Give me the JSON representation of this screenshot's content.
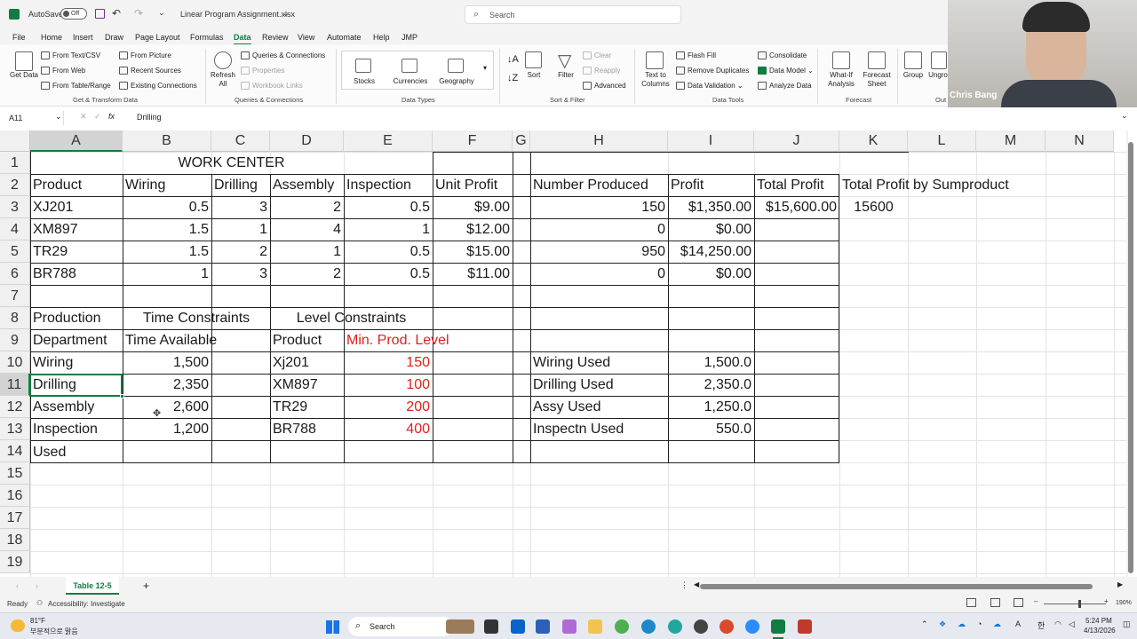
{
  "titlebar": {
    "autosave_label": "AutoSave",
    "autosave_state": "Off",
    "filename": "Linear Program Assignment.xlsx",
    "search_placeholder": "Search"
  },
  "tabs": [
    "File",
    "Home",
    "Insert",
    "Draw",
    "Page Layout",
    "Formulas",
    "Data",
    "Review",
    "View",
    "Automate",
    "Help",
    "JMP"
  ],
  "active_tab": "Data",
  "ribbon": {
    "get_data": "Get Data",
    "from_text_csv": "From Text/CSV",
    "from_web": "From Web",
    "from_table_range": "From Table/Range",
    "from_picture": "From Picture",
    "recent_sources": "Recent Sources",
    "existing_connections": "Existing Connections",
    "group_get_transform": "Get & Transform Data",
    "refresh_all": "Refresh All",
    "queries_connections": "Queries & Connections",
    "properties": "Properties",
    "workbook_links": "Workbook Links",
    "group_queries": "Queries & Connections",
    "stocks": "Stocks",
    "currencies": "Currencies",
    "geography": "Geography",
    "group_data_types": "Data Types",
    "sort_label": "Sort",
    "filter_label": "Filter",
    "clear": "Clear",
    "reapply": "Reapply",
    "advanced": "Advanced",
    "group_sort_filter": "Sort & Filter",
    "text_to_columns": "Text to Columns",
    "flash_fill": "Flash Fill",
    "remove_duplicates": "Remove Duplicates",
    "data_validation": "Data Validation",
    "consolidate": "Consolidate",
    "data_model": "Data Model",
    "analyze_data": "Analyze Data",
    "group_data_tools": "Data Tools",
    "what_if": "What-If Analysis",
    "forecast_sheet": "Forecast Sheet",
    "group_forecast": "Forecast",
    "group": "Group",
    "ungroup": "Ungro",
    "group_outline": "Out"
  },
  "formula_bar": {
    "name_box": "A11",
    "fx": "fx",
    "content": "Drilling"
  },
  "columns": [
    "A",
    "B",
    "C",
    "D",
    "E",
    "F",
    "G",
    "H",
    "I",
    "J",
    "K",
    "L",
    "M",
    "N"
  ],
  "rows": [
    "1",
    "2",
    "3",
    "4",
    "5",
    "6",
    "7",
    "8",
    "9",
    "10",
    "11",
    "12",
    "13",
    "14",
    "15",
    "16",
    "17",
    "18",
    "19"
  ],
  "cells": {
    "work_center": "WORK CENTER",
    "header": [
      "Product",
      "Wiring",
      "Drilling",
      "Assembly",
      "Inspection",
      "Unit Profit",
      "Number Produced",
      "Profit",
      "Total Profit",
      "Total Profit by Sumproduct"
    ],
    "products": [
      {
        "name": "XJ201",
        "wiring": "0.5",
        "drilling": "3",
        "assembly": "2",
        "inspection": "0.5",
        "unit_profit": "$9.00",
        "produced": "150",
        "profit": "$1,350.00"
      },
      {
        "name": "XM897",
        "wiring": "1.5",
        "drilling": "1",
        "assembly": "4",
        "inspection": "1",
        "unit_profit": "$12.00",
        "produced": "0",
        "profit": "$0.00"
      },
      {
        "name": "TR29",
        "wiring": "1.5",
        "drilling": "2",
        "assembly": "1",
        "inspection": "0.5",
        "unit_profit": "$15.00",
        "produced": "950",
        "profit": "$14,250.00"
      },
      {
        "name": "BR788",
        "wiring": "1",
        "drilling": "3",
        "assembly": "2",
        "inspection": "0.5",
        "unit_profit": "$11.00",
        "produced": "0",
        "profit": "$0.00"
      }
    ],
    "total_profit": "$15,600.00",
    "sumproduct": "15600",
    "production": "Production",
    "time_constraints": "Time Constraints",
    "level_constraints": "Level Constraints",
    "department": "Department",
    "time_available": "Time Available",
    "product_label": "Product",
    "min_prod_level": "Min. Prod. Level",
    "departments": [
      {
        "name": "Wiring",
        "time": "1,500",
        "product": "Xj201",
        "min": "150",
        "used_label": "Wiring Used",
        "used": "1,500.0"
      },
      {
        "name": "Drilling",
        "time": "2,350",
        "product": "XM897",
        "min": "100",
        "used_label": "Drilling Used",
        "used": "2,350.0"
      },
      {
        "name": "Assembly",
        "time": "2,600",
        "product": "TR29",
        "min": "200",
        "used_label": "Assy Used",
        "used": "1,250.0"
      },
      {
        "name": "Inspection",
        "time": "1,200",
        "product": "BR788",
        "min": "400",
        "used_label": "Inspectn Used",
        "used": "550.0"
      }
    ],
    "used": "Used"
  },
  "sheet_tab": "Table 12-5",
  "status": {
    "ready": "Ready",
    "accessibility": "Accessibility: Investigate",
    "zoom": "190%"
  },
  "taskbar": {
    "temp": "81°F",
    "weather": "부분적으로 맑음",
    "search": "Search",
    "time": "5:24 PM",
    "date": "4/13/2026",
    "lang": "한"
  },
  "webcam": {
    "name": "Chris Bang"
  },
  "colors": {
    "accent": "#107c41",
    "red_values": "#e0201c"
  }
}
